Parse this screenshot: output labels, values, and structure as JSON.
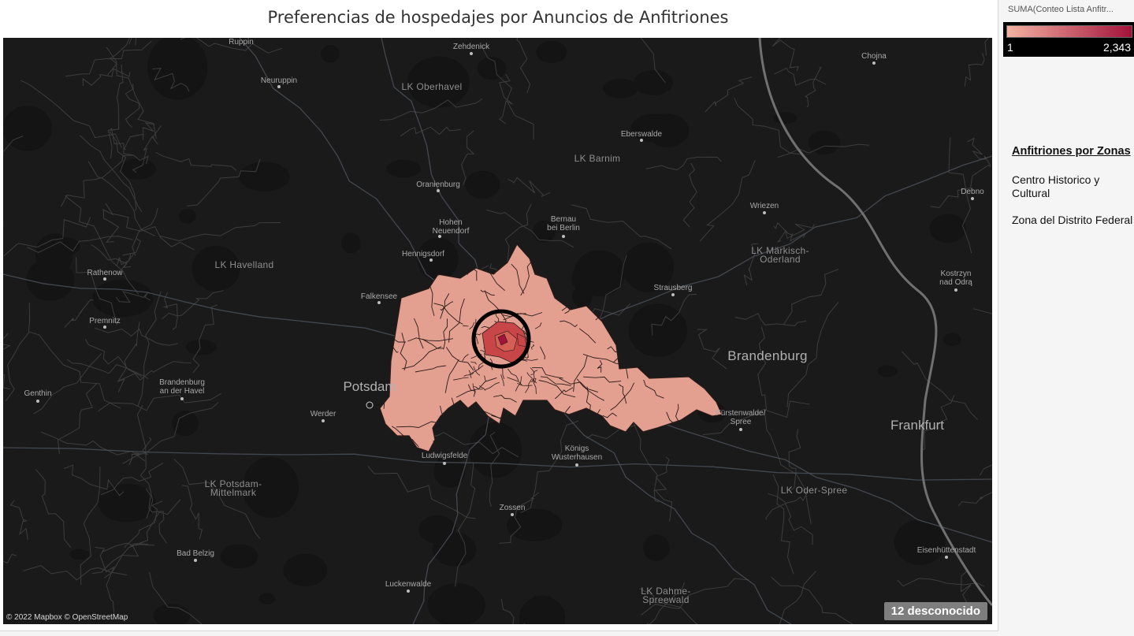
{
  "title": "Preferencias de hospedajes por Anuncios de Anfitriones",
  "legend": {
    "title": "SUMA(Conteo Lista Anfitr...",
    "min": "1",
    "max": "2,343",
    "color_low": "#f4b3a2",
    "color_high": "#a3123b"
  },
  "zones_panel": {
    "heading": "Anfitriones por Zonas",
    "items": [
      "Centro Historico y Cultural",
      "Zona del Distrito Federal"
    ]
  },
  "map": {
    "attribution": "© 2022 Mapbox © OpenStreetMap",
    "unknown_badge": "12 desconocido",
    "colors": {
      "background": "#1a1a1a",
      "boundaries": "#3d3d3d",
      "roads": "#4e545c",
      "river": "#707070",
      "region_fill": "#e3a091",
      "region_stroke": "#2a1a18",
      "center_high": "#a3123b",
      "center_mid": "#c94648",
      "highlight_ring": "#000000"
    },
    "places": [
      {
        "name": "Ruppin"
      },
      {
        "name": "Zehdenick"
      },
      {
        "name": "Neuruppin"
      },
      {
        "name": "LK Oberhavel"
      },
      {
        "name": "Chojna"
      },
      {
        "name": "Eberswalde"
      },
      {
        "name": "LK Barnim"
      },
      {
        "name": "Oranienburg"
      },
      {
        "name": "Debno"
      },
      {
        "name": "Hohen\nNeuendorf"
      },
      {
        "name": "Bernau\nbei Berlin"
      },
      {
        "name": "Wriezen"
      },
      {
        "name": "Hennigsdorf"
      },
      {
        "name": "LK Havelland"
      },
      {
        "name": "LK Märkisch-\nOderland"
      },
      {
        "name": "Rathenow"
      },
      {
        "name": "Kostrzyn\nnad Odrą"
      },
      {
        "name": "Falkensee"
      },
      {
        "name": "Strausberg"
      },
      {
        "name": "Premnitz"
      },
      {
        "name": "Brandenburg"
      },
      {
        "name": "Brandenburg\nan der Havel"
      },
      {
        "name": "Potsdam"
      },
      {
        "name": "Genthin"
      },
      {
        "name": "Werder"
      },
      {
        "name": "Fürstenwalde/\nSpree"
      },
      {
        "name": "Frankfurt"
      },
      {
        "name": "Königs\nWusterhausen"
      },
      {
        "name": "Ludwigsfelde"
      },
      {
        "name": "LK Potsdam-\nMittelmark"
      },
      {
        "name": "LK Oder-Spree"
      },
      {
        "name": "Zossen"
      },
      {
        "name": "Eisenhüttenstadt"
      },
      {
        "name": "Bad Belzig"
      },
      {
        "name": "Luckenwalde"
      },
      {
        "name": "LK Dahme-\nSpreewald"
      }
    ]
  }
}
